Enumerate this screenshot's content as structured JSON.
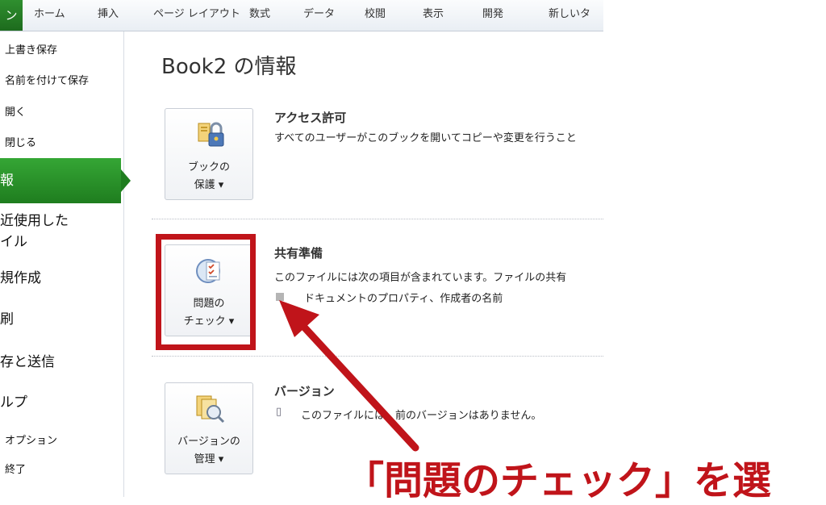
{
  "ribbon": {
    "file_tab": "ン",
    "tabs": [
      "ホーム",
      "挿入",
      "ページ レイアウト",
      "数式",
      "データ",
      "校閲",
      "表示",
      "開発",
      "新しいタ"
    ]
  },
  "sidebar": {
    "items": [
      {
        "label": "上書き保存"
      },
      {
        "label": "名前を付けて保存"
      },
      {
        "label": "開く"
      },
      {
        "label": "閉じる"
      },
      {
        "label": "報"
      },
      {
        "label": "近使用した"
      },
      {
        "label": "イル"
      },
      {
        "label": "規作成"
      },
      {
        "label": "刷"
      },
      {
        "label": "存と送信"
      },
      {
        "label": "ルプ"
      },
      {
        "label": "オプション"
      },
      {
        "label": "終了"
      }
    ]
  },
  "main": {
    "title": "Book2 の情報",
    "sections": [
      {
        "button_line1": "ブックの",
        "button_line2": "保護 ▾",
        "title": "アクセス許可",
        "desc": "すべてのユーザーがこのブックを開いてコピーや変更を行うこと"
      },
      {
        "button_line1": "問題の",
        "button_line2": "チェック ▾",
        "title": "共有準備",
        "desc": "このファイルには次の項目が含まれています。ファイルの共有",
        "bullet": "ドキュメントのプロパティ、作成者の名前"
      },
      {
        "button_line1": "バージョンの",
        "button_line2": "管理 ▾",
        "title": "バージョン",
        "desc": "このファイルには、前のバージョンはありません。"
      }
    ]
  },
  "annotation": {
    "text": "「問題のチェック」を選",
    "color": "#c0141a"
  },
  "colors": {
    "accent_green": "#2a8f2a",
    "highlight_red": "#c0141a"
  }
}
